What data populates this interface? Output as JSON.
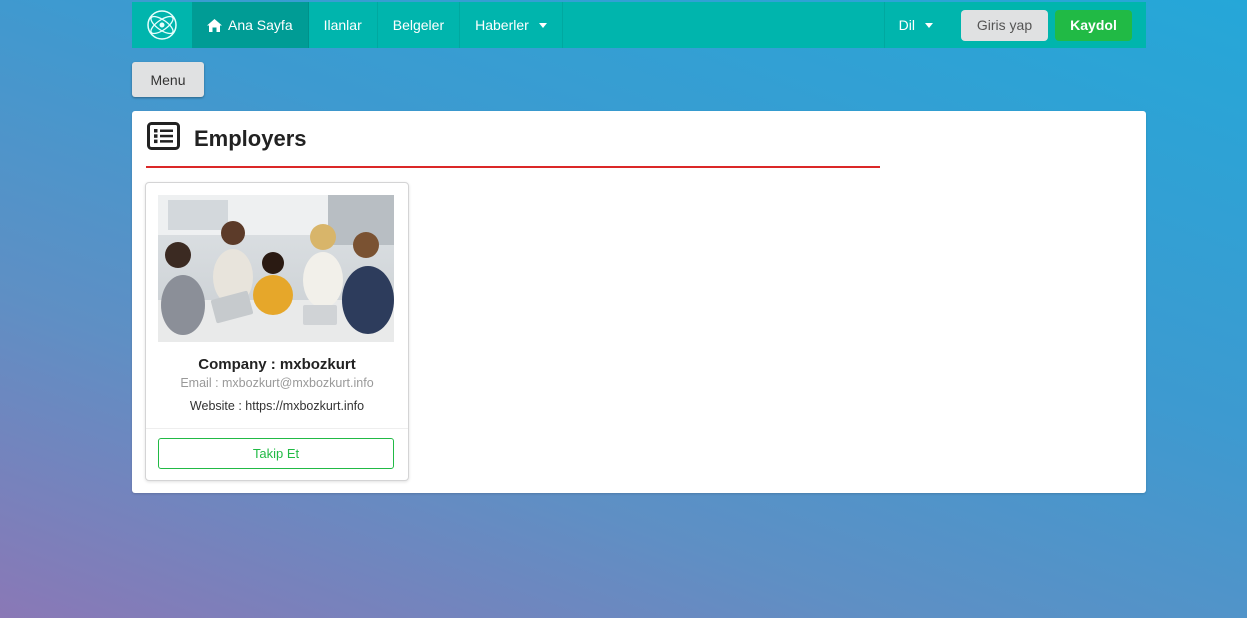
{
  "navbar": {
    "items": [
      {
        "label": "Ana Sayfa",
        "icon": "home-icon",
        "active": true
      },
      {
        "label": "Ilanlar"
      },
      {
        "label": "Belgeler"
      },
      {
        "label": "Haberler",
        "dropdown": true
      }
    ],
    "language_label": "Dil",
    "login_label": "Giris yap",
    "signup_label": "Kaydol"
  },
  "menu_button_label": "Menu",
  "panel": {
    "title": "Employers",
    "icon": "list-icon"
  },
  "employers": [
    {
      "company_line": "Company : mxbozkurt",
      "email_line": "Email : mxbozkurt@mxbozkurt.info",
      "website_line": "Website : https://mxbozkurt.info",
      "follow_label": "Takip Et"
    }
  ],
  "colors": {
    "navbar": "#00b5ad",
    "navbar_active": "#009c95",
    "signup": "#21ba45",
    "divider": "#db2828",
    "follow": "#21ba45"
  }
}
